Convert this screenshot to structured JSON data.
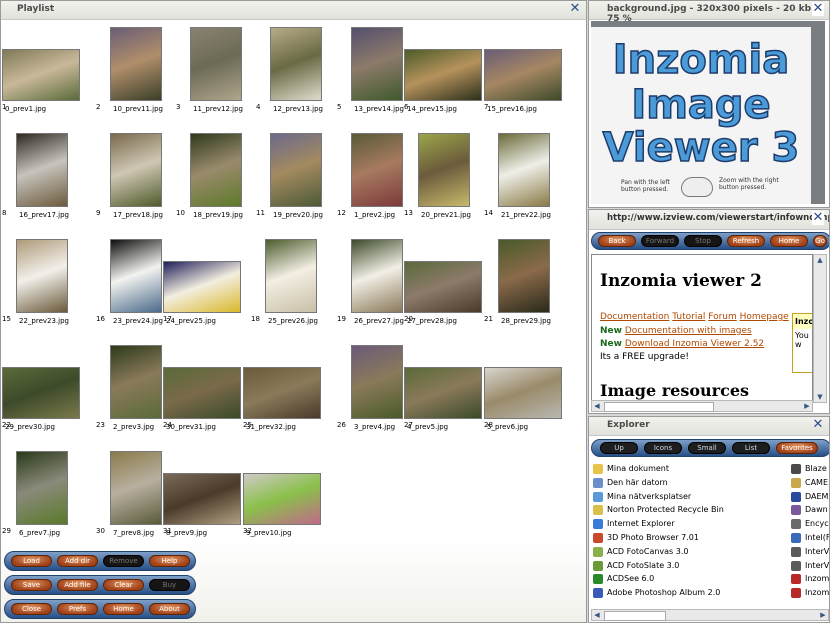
{
  "playlist": {
    "title": "Playlist",
    "thumbnails": [
      {
        "num": "1",
        "file": "0_prev1.jpg",
        "colors": [
          "#7f7a58",
          "#c9b89a",
          "#5a6b3a"
        ]
      },
      {
        "num": "2",
        "file": "10_prev11.jpg",
        "colors": [
          "#6b5d76",
          "#b08e6a",
          "#3b3f2a"
        ]
      },
      {
        "num": "3",
        "file": "11_prev12.jpg",
        "colors": [
          "#8a8272",
          "#6b6a55",
          "#b0a58d"
        ]
      },
      {
        "num": "4",
        "file": "12_prev13.jpg",
        "colors": [
          "#b7ab88",
          "#696a44",
          "#e0dccd"
        ]
      },
      {
        "num": "5",
        "file": "13_prev14.jpg",
        "colors": [
          "#54506f",
          "#8c7a6a",
          "#3f5a2b"
        ]
      },
      {
        "num": "6",
        "file": "14_prev15.jpg",
        "colors": [
          "#4e5c2a",
          "#b5925c",
          "#2d301c"
        ]
      },
      {
        "num": "7",
        "file": "15_prev16.jpg",
        "colors": [
          "#6a5d77",
          "#a68763",
          "#3e4a2a"
        ]
      },
      {
        "num": "8",
        "file": "16_prev17.jpg",
        "colors": [
          "#2e2a22",
          "#c7c3bd",
          "#6d5b3d"
        ]
      },
      {
        "num": "9",
        "file": "17_prev18.jpg",
        "colors": [
          "#7a6a4c",
          "#cfc7b4",
          "#4f5a2a"
        ]
      },
      {
        "num": "10",
        "file": "18_prev19.jpg",
        "colors": [
          "#2f3a1d",
          "#9a8a6c",
          "#5d7a2a"
        ]
      },
      {
        "num": "11",
        "file": "19_prev20.jpg",
        "colors": [
          "#6c6a8c",
          "#a38a5f",
          "#4d5a38"
        ]
      },
      {
        "num": "12",
        "file": "1_prev2.jpg",
        "colors": [
          "#5a5a38",
          "#a77a60",
          "#7d3a3a"
        ]
      },
      {
        "num": "13",
        "file": "20_prev21.jpg",
        "colors": [
          "#9ba54a",
          "#6b5b3c",
          "#c7b86b"
        ]
      },
      {
        "num": "14",
        "file": "21_prev22.jpg",
        "colors": [
          "#6b6a3a",
          "#efefe8",
          "#8a7a48"
        ]
      },
      {
        "num": "15",
        "file": "22_prev23.jpg",
        "colors": [
          "#b09a7a",
          "#f2f0ea",
          "#6a5a3a"
        ]
      },
      {
        "num": "16",
        "file": "23_prev24.jpg",
        "colors": [
          "#0e0e0e",
          "#f3f3f0",
          "#4a6a8a"
        ]
      },
      {
        "num": "17",
        "file": "24_prev25.jpg",
        "colors": [
          "#1f1f5a",
          "#f3eee0",
          "#d9b82a"
        ]
      },
      {
        "num": "18",
        "file": "25_prev26.jpg",
        "colors": [
          "#4b5d2d",
          "#f4eee4",
          "#c7c0a6"
        ]
      },
      {
        "num": "19",
        "file": "26_prev27.jpg",
        "colors": [
          "#3d4a2a",
          "#f2efe6",
          "#8a7a5a"
        ]
      },
      {
        "num": "20",
        "file": "27_prev28.jpg",
        "colors": [
          "#5a6a3a",
          "#8c7a6a",
          "#4a3a2a"
        ]
      },
      {
        "num": "21",
        "file": "28_prev29.jpg",
        "colors": [
          "#4a5a2a",
          "#8a6a4a",
          "#2a2a1a"
        ]
      },
      {
        "num": "22",
        "file": "29_prev30.jpg",
        "colors": [
          "#5c6b3a",
          "#3d4a2a",
          "#7a7a4a"
        ]
      },
      {
        "num": "23",
        "file": "2_prev3.jpg",
        "colors": [
          "#2d3a1a",
          "#8a7a5a",
          "#5a6a3a"
        ]
      },
      {
        "num": "24",
        "file": "30_prev31.jpg",
        "colors": [
          "#5a6a3a",
          "#7a6a4a",
          "#3a4a2a"
        ]
      },
      {
        "num": "25",
        "file": "31_prev32.jpg",
        "colors": [
          "#6a5a3a",
          "#8a7a5a",
          "#4a3a2a"
        ]
      },
      {
        "num": "26",
        "file": "3_prev4.jpg",
        "colors": [
          "#6b5a7a",
          "#8a7a5a",
          "#4a5a2a"
        ]
      },
      {
        "num": "27",
        "file": "4_prev5.jpg",
        "colors": [
          "#5a6a3a",
          "#8a7a5a",
          "#3a4a2a"
        ]
      },
      {
        "num": "28",
        "file": "5_prev6.jpg",
        "colors": [
          "#d8d6cf",
          "#9a8a6a",
          "#b8b8b0"
        ]
      },
      {
        "num": "29",
        "file": "6_prev7.jpg",
        "colors": [
          "#2a3a1a",
          "#8a8a7a",
          "#5a7a2a"
        ]
      },
      {
        "num": "30",
        "file": "7_prev8.jpg",
        "colors": [
          "#8a7a4a",
          "#b8b0a0",
          "#5a5a3a"
        ]
      },
      {
        "num": "31",
        "file": "8_prev9.jpg",
        "colors": [
          "#7a6a5a",
          "#4a3a2a",
          "#b0a080"
        ]
      },
      {
        "num": "32",
        "file": "9_prev10.jpg",
        "colors": [
          "#d0cac8",
          "#8ac04a",
          "#c06a8a"
        ]
      }
    ],
    "buttons": [
      [
        "Load",
        "Add dir",
        "Remove",
        "Help"
      ],
      [
        "Save",
        "Add file",
        "Clear",
        "Buy"
      ],
      [
        "Close",
        "Prefs",
        "Home",
        "About"
      ]
    ],
    "disabled_buttons": [
      "Remove",
      "Buy"
    ]
  },
  "viewer": {
    "title": "background.jpg - 320x300 pixels - 20 kb - 75 %",
    "logo_lines": [
      "Inzomia",
      "Image",
      "Viewer 3"
    ],
    "hint_left": "Pan with the left button pressed.",
    "hint_right": "Zoom with the right button pressed."
  },
  "browser": {
    "url": "http://www.izview.com/viewerstart/infowndphp",
    "nav_buttons": [
      "Back",
      "Forward",
      "Stop",
      "Refresh",
      "Home",
      "Go"
    ],
    "disabled_nav": [
      "Forward",
      "Stop"
    ],
    "heading": "Inzomia viewer 2",
    "links": [
      "Documentation",
      "Tutorial",
      "Forum",
      "Homepage"
    ],
    "new_label": "New",
    "new_items": [
      "Documentation with images",
      "Download Inzomia Viewer 2.52"
    ],
    "upgrade_text": "Its a FREE upgrade!",
    "section_heading": "Image resources",
    "side_box_title": "Inzo",
    "side_box_text": "You ... w"
  },
  "explorer": {
    "title": "Explorer",
    "toolbar": [
      "Up",
      "Icons",
      "Small",
      "List",
      "Favorites"
    ],
    "items": [
      {
        "label": "Mina dokument",
        "icon": "folder-icon",
        "color": "#e8c34a"
      },
      {
        "label": "Den här datorn",
        "icon": "computer-icon",
        "color": "#6b8fc8"
      },
      {
        "label": "Mina nätverksplatser",
        "icon": "network-icon",
        "color": "#5a9ad8"
      },
      {
        "label": "Norton Protected Recycle Bin",
        "icon": "recycle-bin-icon",
        "color": "#d8c04a"
      },
      {
        "label": "Internet Explorer",
        "icon": "internet-explorer-icon",
        "color": "#3a7ad8"
      },
      {
        "label": "3D Photo Browser 7.01",
        "icon": "app-icon",
        "color": "#c84a2a"
      },
      {
        "label": "ACD FotoCanvas 3.0",
        "icon": "app-icon",
        "color": "#8ab04a"
      },
      {
        "label": "ACD FotoSlate 3.0",
        "icon": "app-icon",
        "color": "#6a9a3a"
      },
      {
        "label": "ACDSee 6.0",
        "icon": "app-icon",
        "color": "#2a8a2a"
      },
      {
        "label": "Adobe Photoshop Album 2.0",
        "icon": "app-icon",
        "color": "#3a5ab8"
      }
    ],
    "items_right": [
      {
        "label": "Blaze",
        "color": "#4a4a4a"
      },
      {
        "label": "CAME",
        "color": "#c8a84a"
      },
      {
        "label": "DAEM",
        "color": "#2a4a9a"
      },
      {
        "label": "Dawn",
        "color": "#7a5a9a"
      },
      {
        "label": "Encyc",
        "color": "#6a6a6a"
      },
      {
        "label": "Intel(F",
        "color": "#3a6ab8"
      },
      {
        "label": "InterV",
        "color": "#5a5a5a"
      },
      {
        "label": "InterV",
        "color": "#5a5a5a"
      },
      {
        "label": "Inzom",
        "color": "#b82a2a"
      },
      {
        "label": "Inzom",
        "color": "#b82a2a"
      }
    ]
  }
}
